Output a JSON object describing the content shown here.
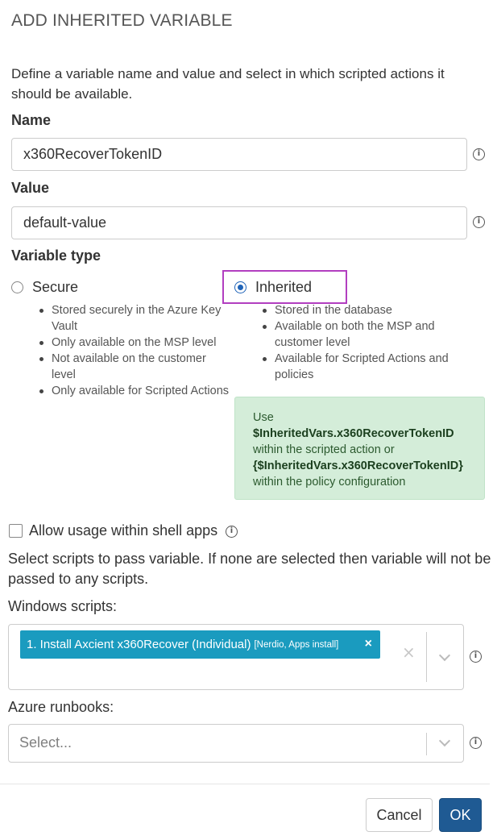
{
  "dialog": {
    "title": "ADD INHERITED VARIABLE",
    "intro": "Define a variable name and value and select in which scripted actions it should be available."
  },
  "name_field": {
    "label": "Name",
    "value": "x360RecoverTokenID"
  },
  "value_field": {
    "label": "Value",
    "value": "default-value"
  },
  "variable_type": {
    "label": "Variable type",
    "secure": {
      "label": "Secure",
      "checked": false,
      "bullets": [
        "Stored securely in the Azure Key Vault",
        "Only available on the MSP level",
        "Not available on the customer level",
        "Only available for Scripted Actions"
      ]
    },
    "inherited": {
      "label": "Inherited",
      "checked": true,
      "bullets": [
        "Stored in the database",
        "Available on both the MSP and customer level",
        "Available for Scripted Actions and policies"
      ]
    }
  },
  "hint": {
    "use": "Use",
    "var1": "$InheritedVars.x360RecoverTokenID",
    "mid": "within the scripted action or",
    "var2": "{$InheritedVars.x360RecoverTokenID}",
    "end": "within the policy configuration"
  },
  "shell_apps": {
    "label": "Allow usage within shell apps",
    "checked": false
  },
  "scripts_help": "Select scripts to pass variable. If none are selected then variable will not be passed to any scripts.",
  "windows_scripts": {
    "label": "Windows scripts:",
    "selected_tag": {
      "label": "1. Install Axcient x360Recover (Individual)",
      "sub": "[Nerdio, Apps install]"
    }
  },
  "azure_runbooks": {
    "label": "Azure runbooks:",
    "placeholder": "Select..."
  },
  "footer": {
    "cancel": "Cancel",
    "ok": "OK"
  },
  "colors": {
    "primary": "#1f5a93",
    "tag": "#1a9bbf",
    "highlight": "#b23ec0",
    "hint_bg": "#d4edd9",
    "radio": "#1e63b8"
  },
  "icons": {
    "info": "info-icon",
    "chevron": "chevron-down-icon",
    "clear": "clear-icon",
    "remove": "remove-tag-icon"
  }
}
